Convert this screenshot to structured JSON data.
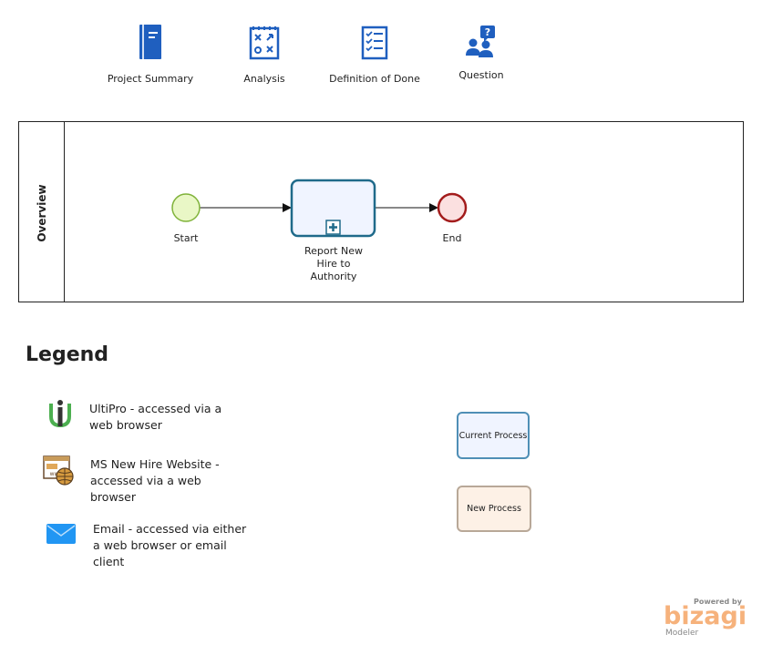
{
  "toolbar": {
    "items": [
      {
        "label": "Project Summary",
        "icon": "book-icon"
      },
      {
        "label": "Analysis",
        "icon": "strategy-icon"
      },
      {
        "label": "Definition of Done",
        "icon": "checklist-icon"
      },
      {
        "label": "Question",
        "icon": "question-people-icon"
      }
    ]
  },
  "diagram": {
    "pool_label": "Overview",
    "start_label": "Start",
    "task_label": "Report New Hire to Authority",
    "end_label": "End",
    "colors": {
      "start_fill": "#e9f7c6",
      "start_stroke": "#7fb239",
      "task_stroke": "#1f6a8a",
      "task_fill": "#f0f4ff",
      "end_fill": "#fbe0e0",
      "end_stroke": "#a31c1c"
    }
  },
  "legend": {
    "title": "Legend",
    "items": [
      {
        "icon": "ultipro-logo-icon",
        "text": "UltiPro - accessed via a web browser"
      },
      {
        "icon": "website-globe-icon",
        "text": "MS New Hire Website - accessed via a web browser"
      },
      {
        "icon": "email-envelope-icon",
        "text": "Email - accessed via either a web browser or email client"
      }
    ],
    "current_process": "Current Process",
    "new_process": "New Process"
  },
  "branding": {
    "powered_by": "Powered by",
    "brand": "bizagi",
    "product": "Modeler"
  }
}
